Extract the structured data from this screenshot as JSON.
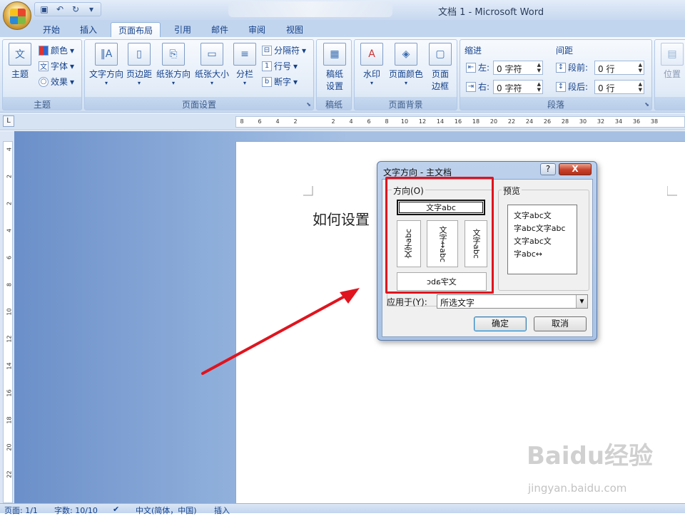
{
  "window": {
    "title": "文档 1 - Microsoft Word"
  },
  "qat": {
    "save": "save-icon",
    "undo": "undo-icon",
    "redo": "redo-icon"
  },
  "tabs": [
    "开始",
    "插入",
    "页面布局",
    "引用",
    "邮件",
    "审阅",
    "视图"
  ],
  "active_tab": "页面布局",
  "ribbon": {
    "theme": {
      "big": "主题",
      "color": "颜色",
      "font": "字体",
      "effect": "效果",
      "label": "主题"
    },
    "page_setup": {
      "text_dir": "文字方向",
      "margins": "页边距",
      "orientation": "纸张方向",
      "size": "纸张大小",
      "columns": "分栏",
      "breaks": "分隔符",
      "line_numbers": "行号",
      "hyphen": "断字",
      "label": "页面设置"
    },
    "draft": {
      "btn_line1": "稿纸",
      "btn_line2": "设置",
      "label": "稿纸"
    },
    "background": {
      "watermark": "水印",
      "page_color": "页面颜色",
      "border_line1": "页面",
      "border_line2": "边框",
      "label": "页面背景"
    },
    "paragraph": {
      "indent": "缩进",
      "left": "左:",
      "right": "右:",
      "left_val": "0 字符",
      "right_val": "0 字符",
      "spacing": "间距",
      "before": "段前:",
      "after": "段后:",
      "before_val": "0 行",
      "after_val": "0 行",
      "label": "段落"
    },
    "arrange": {
      "position": "位置"
    }
  },
  "ruler": {
    "h_ticks": [
      "8",
      "6",
      "4",
      "2",
      "2",
      "4",
      "6",
      "8",
      "10",
      "12",
      "14",
      "16",
      "18",
      "20",
      "22",
      "24",
      "26",
      "28",
      "30",
      "32",
      "34",
      "36",
      "38"
    ],
    "v_ticks": [
      "4",
      "2",
      "2",
      "4",
      "6",
      "8",
      "10",
      "12",
      "14",
      "16",
      "18",
      "20",
      "22"
    ]
  },
  "document": {
    "text": "如何设置"
  },
  "dialog": {
    "title": "文字方向 - 主文档",
    "help": "?",
    "close": "X",
    "direction_label": "方向(O)",
    "opt_horizontal": "文字abc",
    "opt_v1": "文字abc",
    "opt_v2": "文字↔abc",
    "opt_v3": "文字abc",
    "opt_bottom": "文字abc",
    "preview_label": "预览",
    "preview_lines": [
      "文字abc文",
      "字abc文字abc",
      "文字abc文",
      "字abc↔"
    ],
    "apply_label": "应用于(Y):",
    "apply_value": "所选文字",
    "ok": "确定",
    "cancel": "取消"
  },
  "status": {
    "page": "页面: 1/1",
    "words": "字数: 10/10",
    "lang": "中文(简体，中国)",
    "mode": "插入"
  },
  "watermark": {
    "brand": "Baidu经验",
    "url": "jingyan.baidu.com"
  },
  "colors": {
    "highlight": "#e0141e",
    "ribbon_text": "#15428b"
  }
}
